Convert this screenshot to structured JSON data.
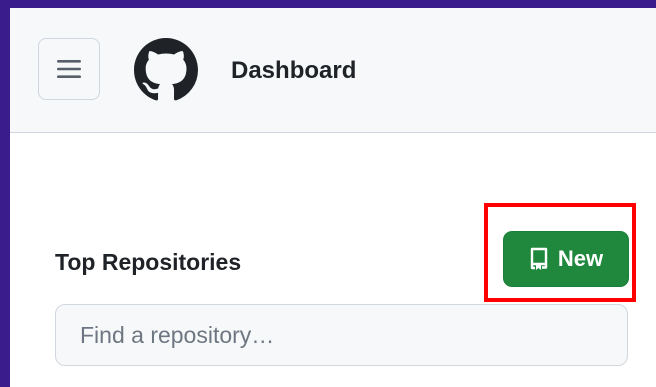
{
  "header": {
    "title": "Dashboard",
    "menu_icon": "hamburger-menu-icon",
    "logo_icon": "github-logo-icon"
  },
  "repositories": {
    "section_title": "Top Repositories",
    "new_button": {
      "label": "New",
      "icon": "repo-icon",
      "highlighted": true
    },
    "search": {
      "placeholder": "Find a repository…",
      "value": ""
    }
  },
  "colors": {
    "frame_border": "#3b1c8c",
    "header_background": "#f6f8fa",
    "new_button_background": "#1f883d",
    "highlight": "#ff0000",
    "text": "#1f2328",
    "placeholder": "#6e7781"
  }
}
